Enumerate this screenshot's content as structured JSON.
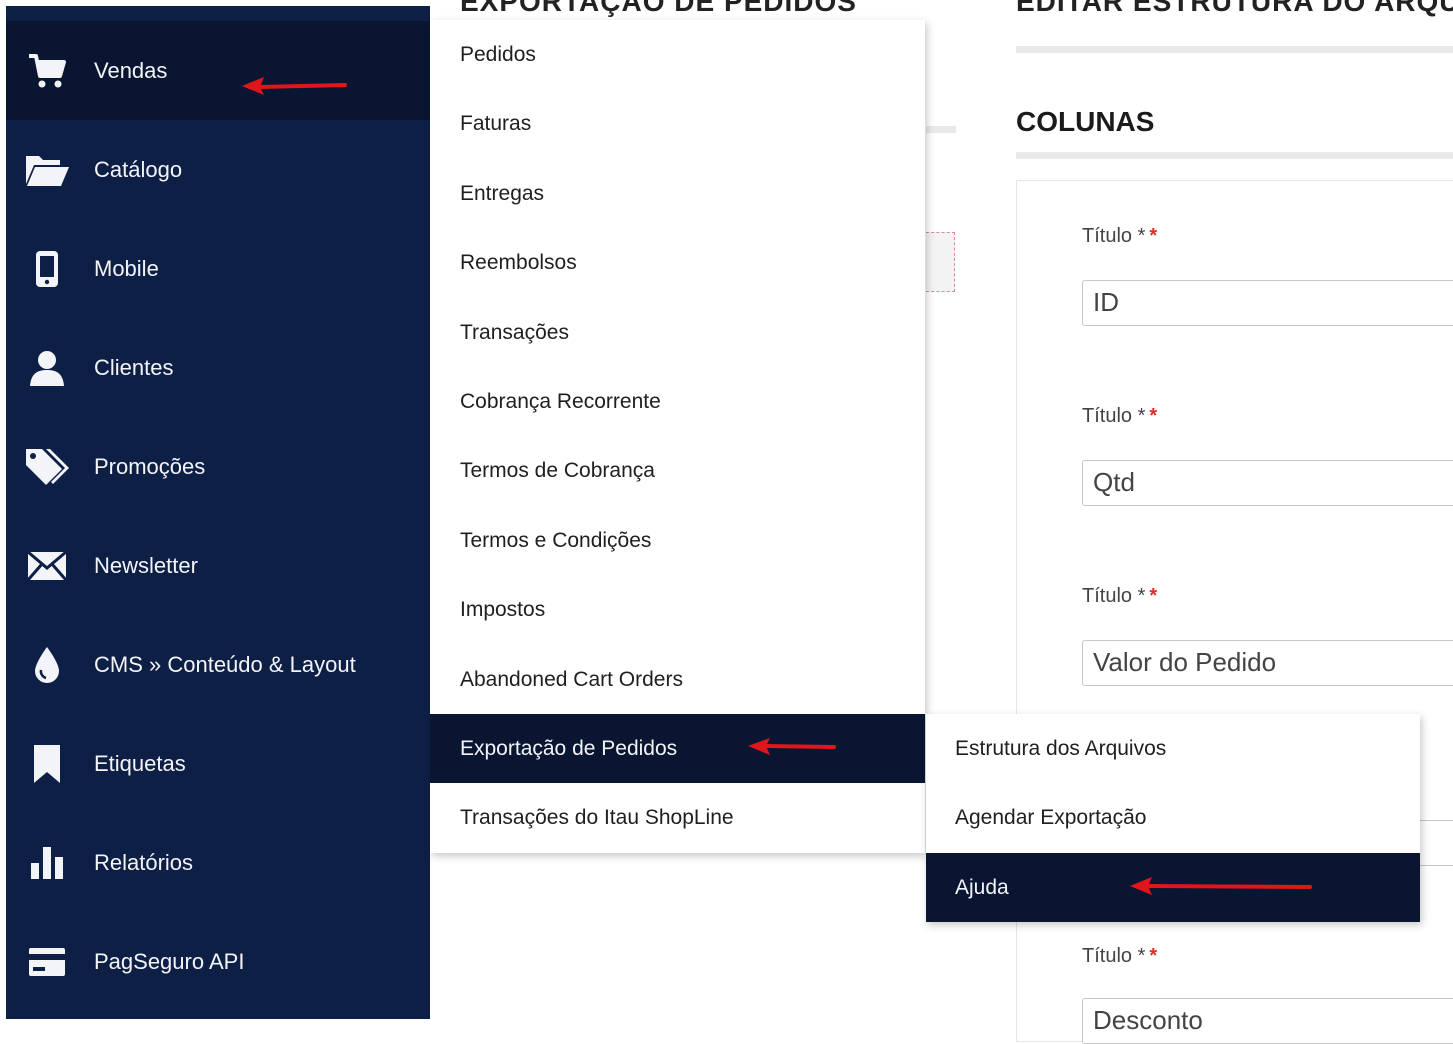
{
  "colors": {
    "sidebar_bg": "#0e1f46",
    "active_bg": "#0a1531",
    "arrow": "#e0161b",
    "required": "#e02b27"
  },
  "background": {
    "heading_left": "EXPORTAÇÃO DE PEDIDOS",
    "heading_right": "EDITAR ESTRUTURA DO ARQUIVO",
    "colunas_title": "COLUNAS",
    "fields": [
      {
        "label": "Título *",
        "required_mark": "*",
        "value": "ID"
      },
      {
        "label": "Título *",
        "required_mark": "*",
        "value": "Qtd"
      },
      {
        "label": "Título *",
        "required_mark": "*",
        "value": "Valor do Pedido"
      },
      {
        "label": "Título *",
        "required_mark": "*",
        "value": "Desconto"
      }
    ]
  },
  "sidebar": {
    "items": [
      {
        "label": "Vendas",
        "icon": "cart-icon",
        "active": true
      },
      {
        "label": "Catálogo",
        "icon": "folder-open-icon"
      },
      {
        "label": "Mobile",
        "icon": "mobile-icon"
      },
      {
        "label": "Clientes",
        "icon": "user-icon"
      },
      {
        "label": "Promoções",
        "icon": "tags-icon"
      },
      {
        "label": "Newsletter",
        "icon": "envelope-icon"
      },
      {
        "label": "CMS » Conteúdo & Layout",
        "icon": "droplet-icon"
      },
      {
        "label": "Etiquetas",
        "icon": "bookmark-icon"
      },
      {
        "label": "Relatórios",
        "icon": "bar-chart-icon"
      },
      {
        "label": "PagSeguro API",
        "icon": "credit-card-icon"
      }
    ]
  },
  "submenu": {
    "items": [
      {
        "label": "Pedidos"
      },
      {
        "label": "Faturas"
      },
      {
        "label": "Entregas"
      },
      {
        "label": "Reembolsos"
      },
      {
        "label": "Transações"
      },
      {
        "label": "Cobrança Recorrente"
      },
      {
        "label": "Termos de Cobrança"
      },
      {
        "label": "Termos e Condições"
      },
      {
        "label": "Impostos"
      },
      {
        "label": "Abandoned Cart Orders"
      },
      {
        "label": "Exportação de Pedidos",
        "active": true
      },
      {
        "label": "Transações do Itau ShopLine"
      }
    ]
  },
  "submenu2": {
    "items": [
      {
        "label": "Estrutura dos Arquivos"
      },
      {
        "label": "Agendar Exportação"
      },
      {
        "label": "Ajuda",
        "active": true
      }
    ]
  }
}
